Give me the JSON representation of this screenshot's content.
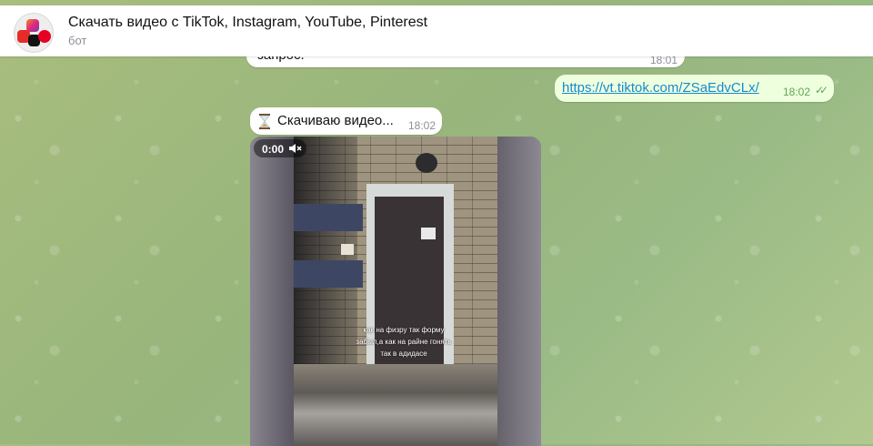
{
  "header": {
    "title": "Скачать видео с TikTok, Instagram, YouTube, Pinterest",
    "subtitle": "бот"
  },
  "messages": {
    "previous": {
      "text": "запрос.",
      "time": "18:01"
    },
    "outgoing": {
      "link": "https://vt.tiktok.com/ZSaEdvCLx/",
      "time": "18:02",
      "status": "read"
    },
    "incoming": {
      "text": "Скачиваю видео...",
      "time": "18:02",
      "icon": "hourglass-icon"
    }
  },
  "video": {
    "time": "0:00",
    "muted": true,
    "caption": "как на физру так форму забыл,а как на райне гонять так в адидасе"
  },
  "colors": {
    "chat_background": "#9fba80",
    "outgoing_bubble": "#eeffde",
    "link": "#168acd",
    "read_check": "#5fa756"
  }
}
